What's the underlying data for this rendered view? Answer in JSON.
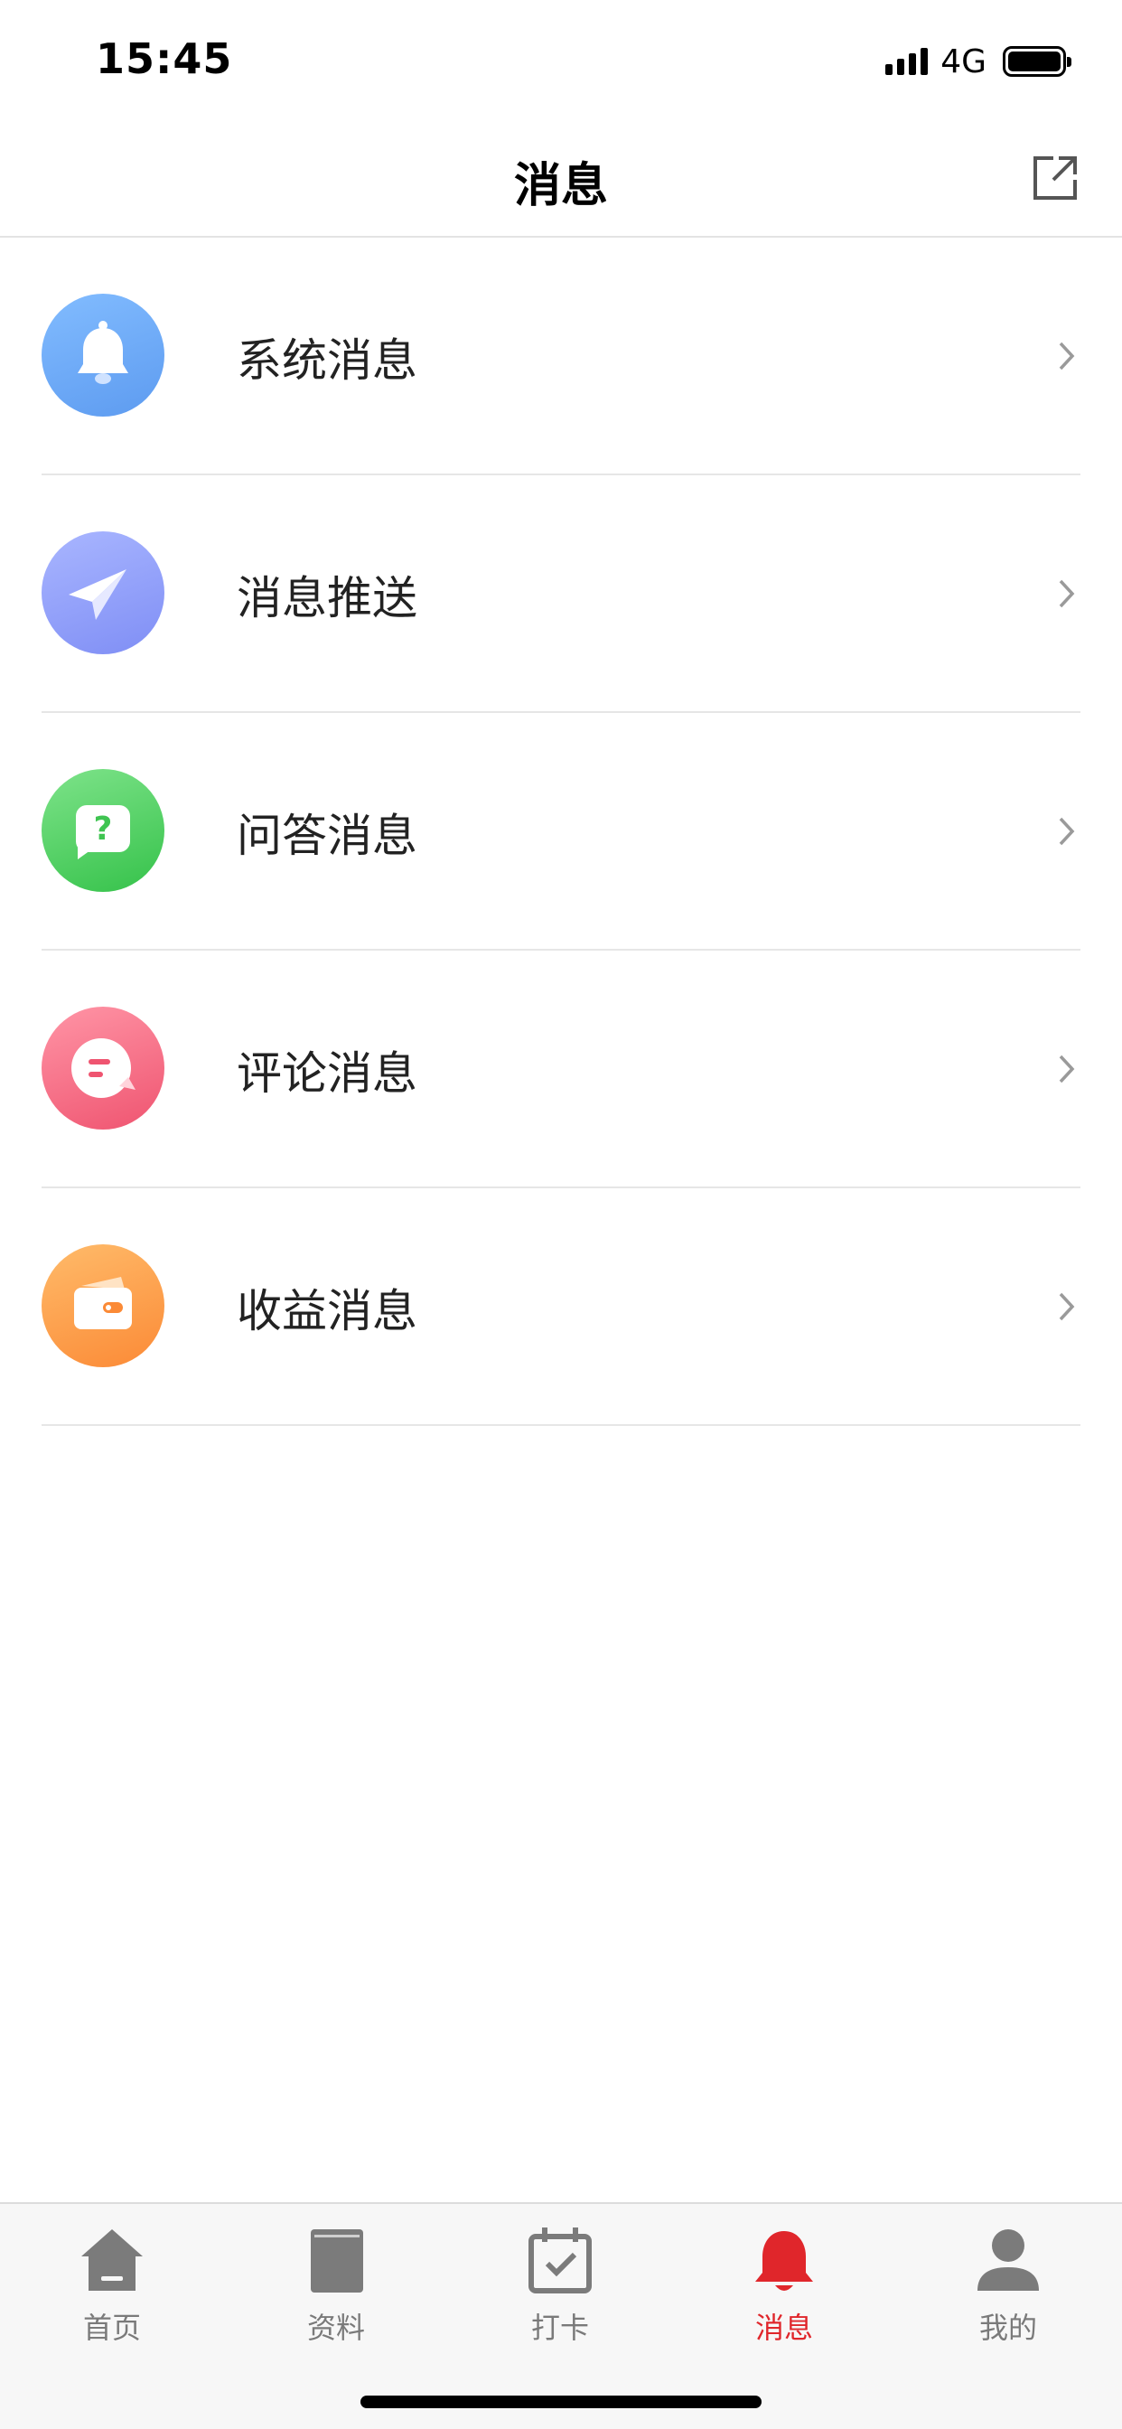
{
  "status_bar": {
    "time": "15:45",
    "network": "4G"
  },
  "nav": {
    "title": "消息"
  },
  "items": [
    {
      "label": "系统消息"
    },
    {
      "label": "消息推送"
    },
    {
      "label": "问答消息"
    },
    {
      "label": "评论消息"
    },
    {
      "label": "收益消息"
    }
  ],
  "tabs": [
    {
      "label": "首页"
    },
    {
      "label": "资料"
    },
    {
      "label": "打卡"
    },
    {
      "label": "消息"
    },
    {
      "label": "我的"
    }
  ],
  "colors": {
    "accent": "#e0262b",
    "system_icon": "#6aa8f7",
    "push_icon": "#8f9cf8",
    "qa_icon": "#4ccf5d",
    "comment_icon": "#f56d86",
    "income_icon": "#fb9a46"
  }
}
